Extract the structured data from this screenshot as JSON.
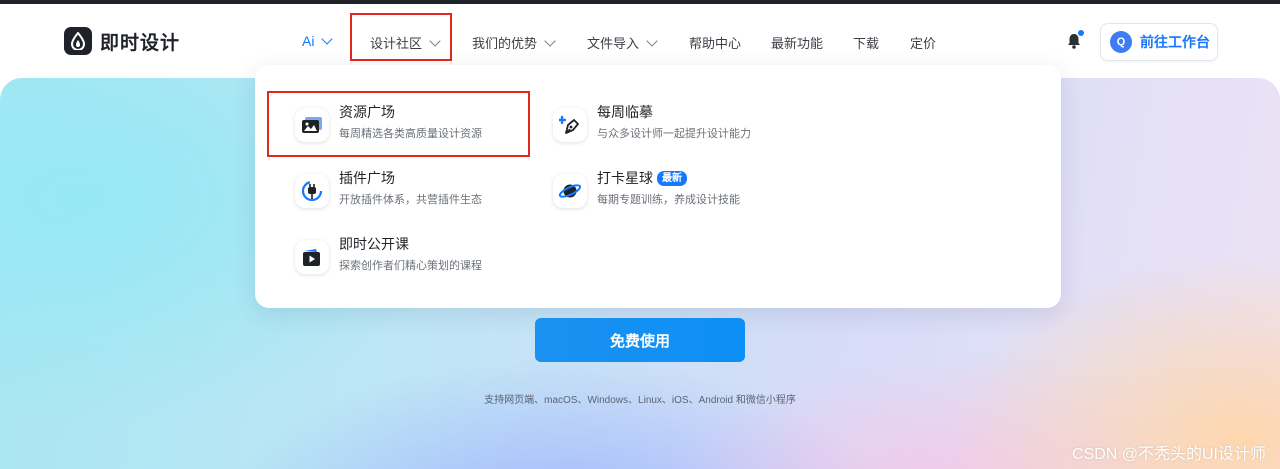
{
  "header": {
    "logo_text": "即时设计",
    "nav": [
      {
        "label": "Ai",
        "has_dropdown": true
      },
      {
        "label": "设计社区",
        "has_dropdown": true,
        "highlighted": true
      },
      {
        "label": "我们的优势",
        "has_dropdown": true
      },
      {
        "label": "文件导入",
        "has_dropdown": true
      },
      {
        "label": "帮助中心",
        "has_dropdown": false
      },
      {
        "label": "最新功能",
        "has_dropdown": false
      },
      {
        "label": "下载",
        "has_dropdown": false
      },
      {
        "label": "定价",
        "has_dropdown": false
      }
    ],
    "avatar_letter": "Q",
    "workbench_label": "前往工作台"
  },
  "community_menu": {
    "items": [
      {
        "title": "资源广场",
        "desc": "每周精选各类高质量设计资源",
        "icon": "image-gallery-icon",
        "highlighted": true
      },
      {
        "title": "每周临摹",
        "desc": "与众多设计师一起提升设计能力",
        "icon": "pen-plus-icon"
      },
      {
        "title": "插件广场",
        "desc": "开放插件体系，共营插件生态",
        "icon": "plug-icon"
      },
      {
        "title": "打卡星球",
        "desc": "每期专题训练，养成设计技能",
        "icon": "planet-icon",
        "badge": "最新"
      },
      {
        "title": "即时公开课",
        "desc": "探索创作者们精心策划的课程",
        "icon": "video-play-icon"
      }
    ]
  },
  "hero": {
    "cta_label": "免费使用",
    "platforms": "支持网页端、macOS、Windows、Linux、iOS、Android 和微信小程序"
  },
  "watermark": "CSDN @不秃头的UI设计师",
  "colors": {
    "accent": "#1677ff",
    "highlight_box": "#e0271c",
    "dark": "#1f2329"
  }
}
